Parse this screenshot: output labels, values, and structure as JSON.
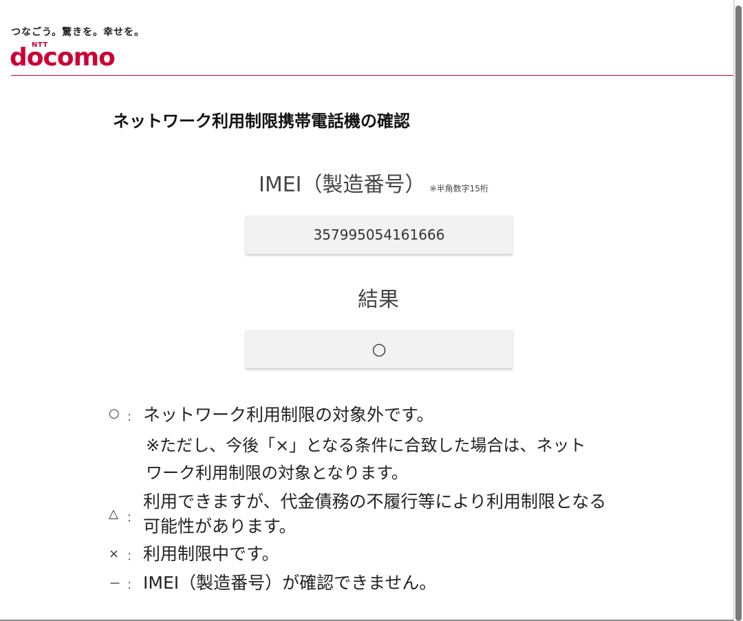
{
  "header": {
    "tagline": "つなごう。驚きを。幸せを。",
    "logo_small": "NTT",
    "logo_text": "docomo",
    "brand_color": "#cc0033"
  },
  "page_title": "ネットワーク利用制限携帯電話機の確認",
  "imei": {
    "heading": "IMEI（製造番号）",
    "note": "※半角数字15桁",
    "value": "357995054161666"
  },
  "result": {
    "heading": "結果",
    "value": "○"
  },
  "legend": [
    {
      "symbol": "○",
      "colon": "：",
      "text": "ネットワーク利用制限の対象外です。",
      "note_line1": "※ただし、今後「×」となる条件に合致した場合は、ネット",
      "note_line2": "ワーク利用制限の対象となります。"
    },
    {
      "symbol": "△",
      "colon": "：",
      "text_line1": "利用できますが、代金債務の不履行等により利用制限となる",
      "text_line2": "可能性があります。"
    },
    {
      "symbol": "×",
      "colon": "：",
      "text": "利用制限中です。"
    },
    {
      "symbol": "－",
      "colon": "：",
      "text": "IMEI（製造番号）が確認できません。"
    }
  ]
}
